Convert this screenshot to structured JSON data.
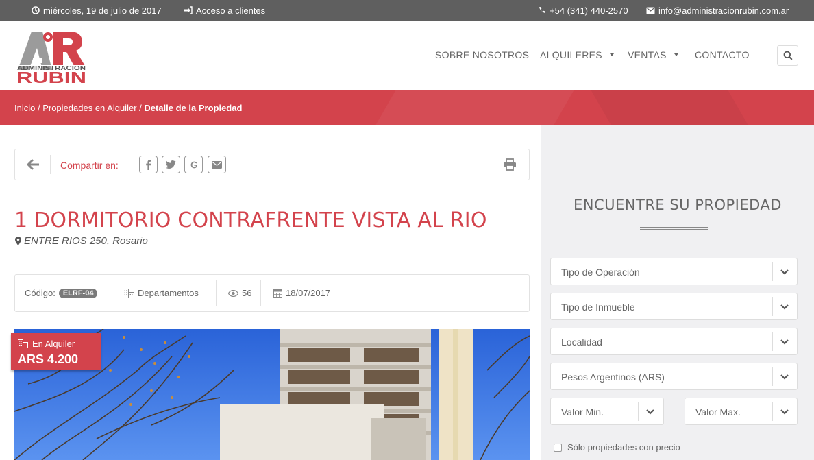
{
  "topbar": {
    "date": "miércoles, 19 de julio de 2017",
    "login": "Acceso a clientes",
    "phone": "+54 (341) 440-2570",
    "email": "info@administracionrubin.com.ar"
  },
  "logo": {
    "letters": "AR",
    "line1": "ADMINISTRACION",
    "line2": "RUBIN"
  },
  "nav": {
    "items": [
      "SOBRE NOSOTROS",
      "ALQUILERES",
      "VENTAS",
      "CONTACTO"
    ]
  },
  "breadcrumb": {
    "home": "Inicio",
    "section": "Propiedades en Alquiler",
    "current": "Detalle de la Propiedad",
    "sep": " / "
  },
  "share": {
    "label": "Compartir en:",
    "networks": [
      "f",
      "twitter",
      "g+",
      "email"
    ]
  },
  "property": {
    "title": "1 DORMITORIO CONTRAFRENTE VISTA AL RIO",
    "address": "ENTRE RIOS 250, Rosario",
    "code_label": "Código:",
    "code": "ELRF-04",
    "type": "Departamentos",
    "views": "56",
    "date": "18/07/2017",
    "status": "En Alquiler",
    "price": "ARS 4.200"
  },
  "sidebar": {
    "title": "ENCUENTRE SU PROPIEDAD",
    "selects": [
      "Tipo de Operación",
      "Tipo de Inmueble",
      "Localidad",
      "Pesos Argentinos (ARS)"
    ],
    "min_label": "Valor Min.",
    "max_label": "Valor Max.",
    "price_only": "Sólo propiedades con precio"
  },
  "colors": {
    "accent": "#d3434c",
    "topbar": "#5f5f5f",
    "sidebar": "#f0f0f2"
  }
}
